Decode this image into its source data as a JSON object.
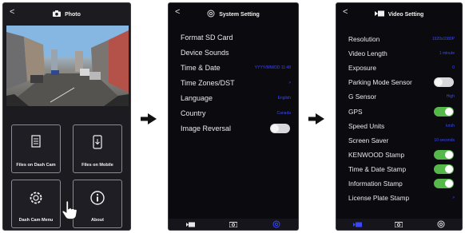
{
  "screen1": {
    "title": "Photo",
    "back_label": "<",
    "tiles": [
      {
        "label": "Files on Dash Cam",
        "icon": "document-icon"
      },
      {
        "label": "Files on Mobile",
        "icon": "mobile-download-icon"
      },
      {
        "label": "Dash Cam Menu",
        "icon": "gear-icon"
      },
      {
        "label": "About",
        "icon": "info-icon"
      }
    ]
  },
  "screen2": {
    "title": "System Setting",
    "back_label": "<",
    "items": [
      {
        "label": "Format SD Card",
        "value": ""
      },
      {
        "label": "Device Sounds",
        "value": ""
      },
      {
        "label": "Time & Date",
        "value": "YYYY/MM/DD 11:48"
      },
      {
        "label": "Time Zones/DST",
        "value": ">"
      },
      {
        "label": "Language",
        "value": "English"
      },
      {
        "label": "Country",
        "value": "Canada"
      },
      {
        "label": "Image Reversal",
        "toggle": "off"
      }
    ]
  },
  "screen3": {
    "title": "Video Setting",
    "back_label": "<",
    "items": [
      {
        "label": "Resolution",
        "value": "1920x1080P"
      },
      {
        "label": "Video Length",
        "value": "1 minute"
      },
      {
        "label": "Exposure",
        "value": "0"
      },
      {
        "label": "Parking Mode Sensor",
        "toggle": "off"
      },
      {
        "label": "G Sensor",
        "value": "High"
      },
      {
        "label": "GPS",
        "toggle": "on"
      },
      {
        "label": "Speed Units",
        "value": "km/h"
      },
      {
        "label": "Screen Saver",
        "value": "10 seconds"
      },
      {
        "label": "KENWOOD Stamp",
        "toggle": "on"
      },
      {
        "label": "Time & Date Stamp",
        "toggle": "on"
      },
      {
        "label": "Information Stamp",
        "toggle": "on"
      },
      {
        "label": "License Plate Stamp",
        "value": ">"
      }
    ]
  },
  "colors": {
    "accent_blue": "#3b47ff",
    "toggle_on": "#56b84a",
    "toggle_off": "#d7d7dc"
  }
}
